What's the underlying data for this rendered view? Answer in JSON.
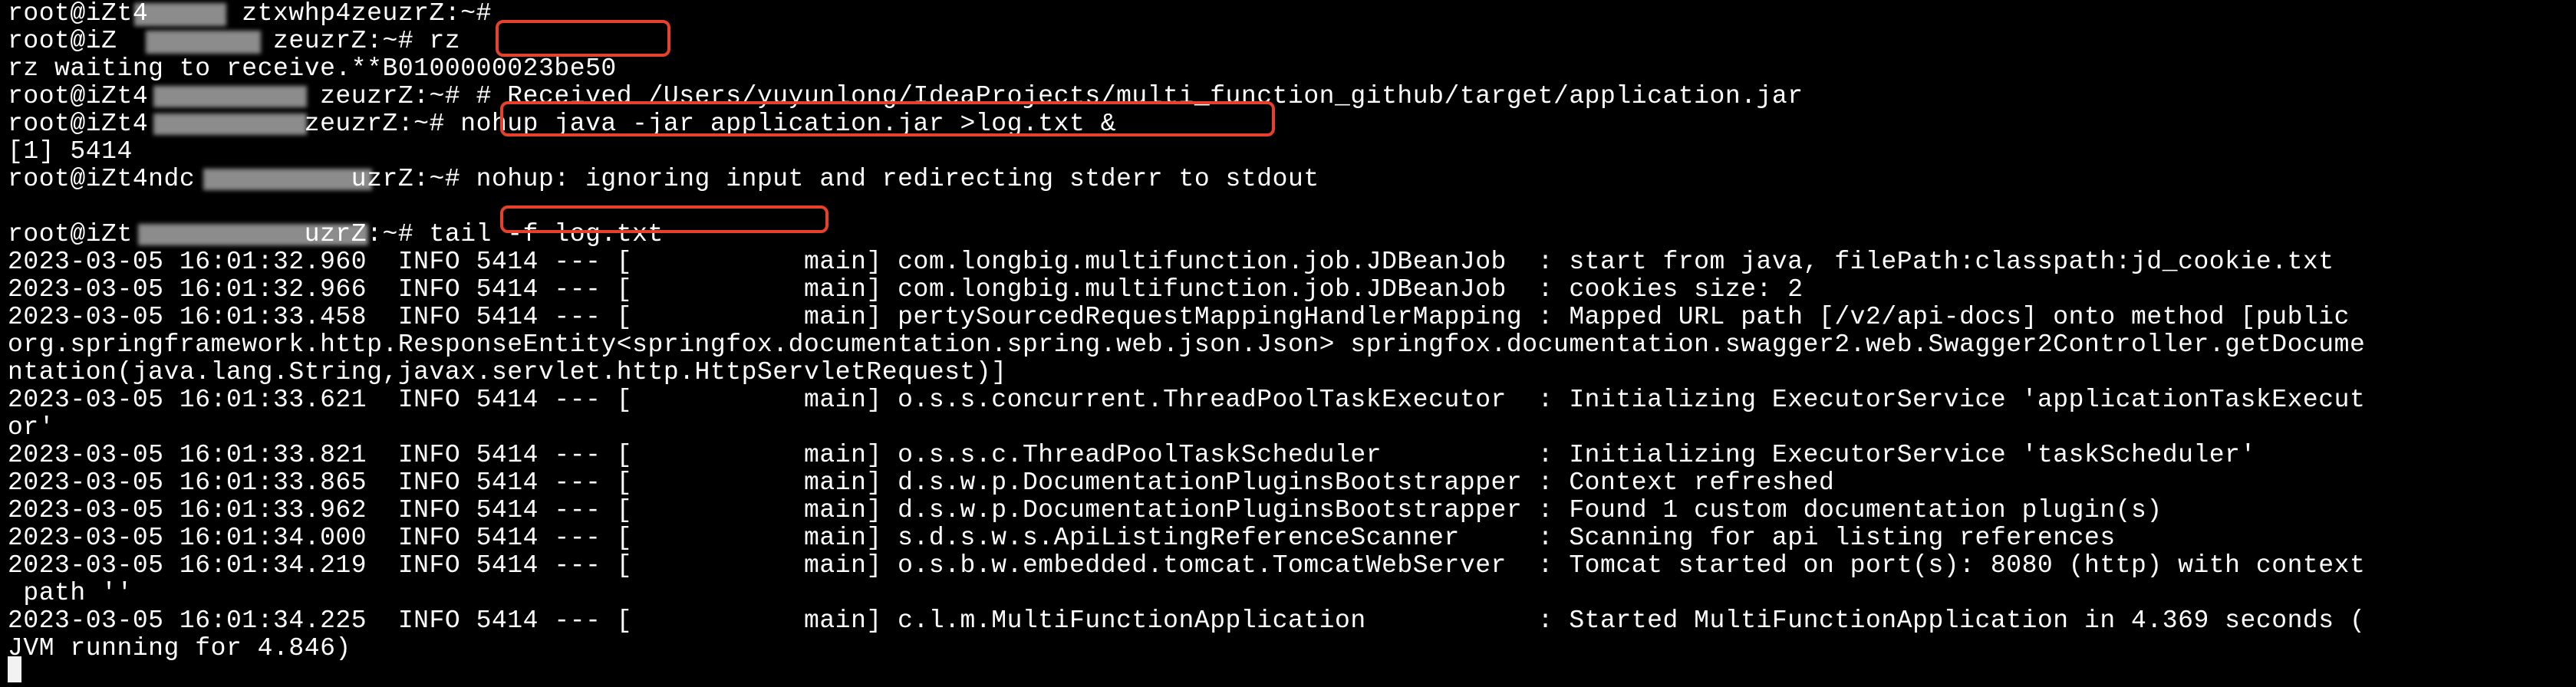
{
  "terminal": {
    "lines": [
      "root@iZt4      ztxwhp4zeuzrZ:~#",
      "root@iZ          zeuzrZ:~# rz",
      "rz waiting to receive.**B0100000023be50",
      "root@iZt4           zeuzrZ:~# # Received /Users/yuyunlong/IdeaProjects/multi_function_github/target/application.jar",
      "root@iZt4          zeuzrZ:~# nohup java -jar application.jar >log.txt &",
      "[1] 5414",
      "root@iZt4ndc          uzrZ:~# nohup: ignoring input and redirecting stderr to stdout",
      "",
      "root@iZt           uzrZ:~# tail -f log.txt",
      "2023-03-05 16:01:32.960  INFO 5414 --- [           main] com.longbig.multifunction.job.JDBeanJob  : start from java, filePath:classpath:jd_cookie.txt",
      "2023-03-05 16:01:32.966  INFO 5414 --- [           main] com.longbig.multifunction.job.JDBeanJob  : cookies size: 2",
      "2023-03-05 16:01:33.458  INFO 5414 --- [           main] pertySourcedRequestMappingHandlerMapping : Mapped URL path [/v2/api-docs] onto method [public",
      "org.springframework.http.ResponseEntity<springfox.documentation.spring.web.json.Json> springfox.documentation.swagger2.web.Swagger2Controller.getDocume",
      "ntation(java.lang.String,javax.servlet.http.HttpServletRequest)]",
      "2023-03-05 16:01:33.621  INFO 5414 --- [           main] o.s.s.concurrent.ThreadPoolTaskExecutor  : Initializing ExecutorService 'applicationTaskExecut",
      "or'",
      "2023-03-05 16:01:33.821  INFO 5414 --- [           main] o.s.s.c.ThreadPoolTaskScheduler          : Initializing ExecutorService 'taskScheduler'",
      "2023-03-05 16:01:33.865  INFO 5414 --- [           main] d.s.w.p.DocumentationPluginsBootstrapper : Context refreshed",
      "2023-03-05 16:01:33.962  INFO 5414 --- [           main] d.s.w.p.DocumentationPluginsBootstrapper : Found 1 custom documentation plugin(s)",
      "2023-03-05 16:01:34.000  INFO 5414 --- [           main] s.d.s.w.s.ApiListingReferenceScanner     : Scanning for api listing references",
      "2023-03-05 16:01:34.219  INFO 5414 --- [           main] o.s.b.w.embedded.tomcat.TomcatWebServer  : Tomcat started on port(s): 8080 (http) with context",
      " path ''",
      "2023-03-05 16:01:34.225  INFO 5414 --- [           main] c.l.m.MultiFunctionApplication           : Started MultiFunctionApplication in 4.369 seconds (",
      "JVM running for 4.846)"
    ]
  },
  "colors": {
    "background": "#000000",
    "text": "#ffffff",
    "highlight": "#e8412b"
  }
}
